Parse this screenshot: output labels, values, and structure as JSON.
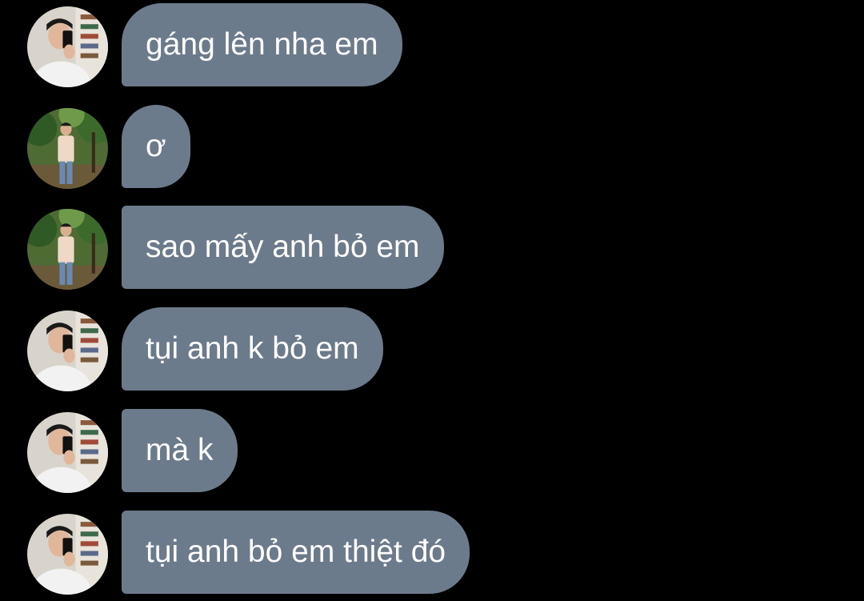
{
  "messages": [
    {
      "text": "gáng lên nha em",
      "avatar": "avatar-mirror-selfie"
    },
    {
      "text": "ơ",
      "avatar": "avatar-garden-photo"
    },
    {
      "text": "sao mấy anh bỏ em",
      "avatar": "avatar-garden-photo"
    },
    {
      "text": "tụi anh k bỏ em",
      "avatar": "avatar-mirror-selfie"
    },
    {
      "text": "mà k",
      "avatar": "avatar-mirror-selfie"
    },
    {
      "text": "tụi anh bỏ em thiệt đó",
      "avatar": "avatar-mirror-selfie"
    }
  ],
  "colors": {
    "background": "#000000",
    "bubble": "#6b7b8b",
    "text": "#ffffff"
  }
}
